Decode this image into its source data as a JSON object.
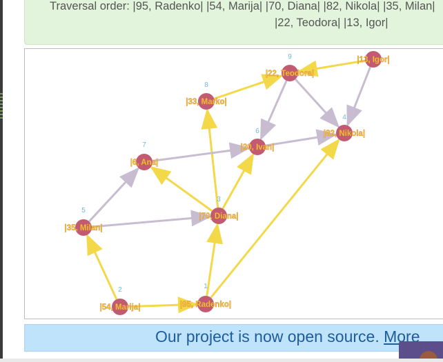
{
  "traversal": {
    "line1": "Traversal order: |95, Radenko| |54, Marija| |70, Diana| |82, Nikola| |35, Milan|",
    "line2": "|22, Teodora| |13, Igor|"
  },
  "graph": {
    "colors": {
      "node_fill": "#c25a72",
      "node_label": "#f3c53a",
      "order_number": "#6fb7dd",
      "edge_traversed": "#f3d84a",
      "edge_other": "#c8bcd1"
    },
    "nodes": [
      {
        "id": "radenko",
        "label": "|95, Radenko|",
        "order": "1"
      },
      {
        "id": "marija",
        "label": "|54, Marija|",
        "order": "2"
      },
      {
        "id": "diana",
        "label": "|70, Diana|",
        "order": "3"
      },
      {
        "id": "nikola",
        "label": "|82, Nikola|",
        "order": "4"
      },
      {
        "id": "milan",
        "label": "|35, Milan|",
        "order": "5"
      },
      {
        "id": "ivan",
        "label": "|20, Ivan|",
        "order": "6"
      },
      {
        "id": "ana",
        "label": "|6, Ana|",
        "order": "7"
      },
      {
        "id": "marko",
        "label": "|33, Marko|",
        "order": "8"
      },
      {
        "id": "teodora",
        "label": "|22, Teodora|",
        "order": "9"
      },
      {
        "id": "igor",
        "label": "|13, Igor|",
        "order": ""
      }
    ],
    "edges": [
      {
        "from": "marija",
        "to": "radenko",
        "traversed": true
      },
      {
        "from": "marija",
        "to": "milan",
        "traversed": true
      },
      {
        "from": "radenko",
        "to": "diana",
        "traversed": true
      },
      {
        "from": "radenko",
        "to": "nikola",
        "traversed": true
      },
      {
        "from": "milan",
        "to": "diana",
        "traversed": false
      },
      {
        "from": "milan",
        "to": "ana",
        "traversed": false
      },
      {
        "from": "diana",
        "to": "ana",
        "traversed": true
      },
      {
        "from": "diana",
        "to": "ivan",
        "traversed": true
      },
      {
        "from": "diana",
        "to": "marko",
        "traversed": true
      },
      {
        "from": "ana",
        "to": "ivan",
        "traversed": false
      },
      {
        "from": "ivan",
        "to": "nikola",
        "traversed": false
      },
      {
        "from": "marko",
        "to": "teodora",
        "traversed": true
      },
      {
        "from": "teodora",
        "to": "ivan",
        "traversed": false
      },
      {
        "from": "teodora",
        "to": "nikola",
        "traversed": false
      },
      {
        "from": "igor",
        "to": "teodora",
        "traversed": true
      },
      {
        "from": "igor",
        "to": "nikola",
        "traversed": false
      }
    ]
  },
  "banner": {
    "text": "Our project is now open source.",
    "link": "More"
  }
}
